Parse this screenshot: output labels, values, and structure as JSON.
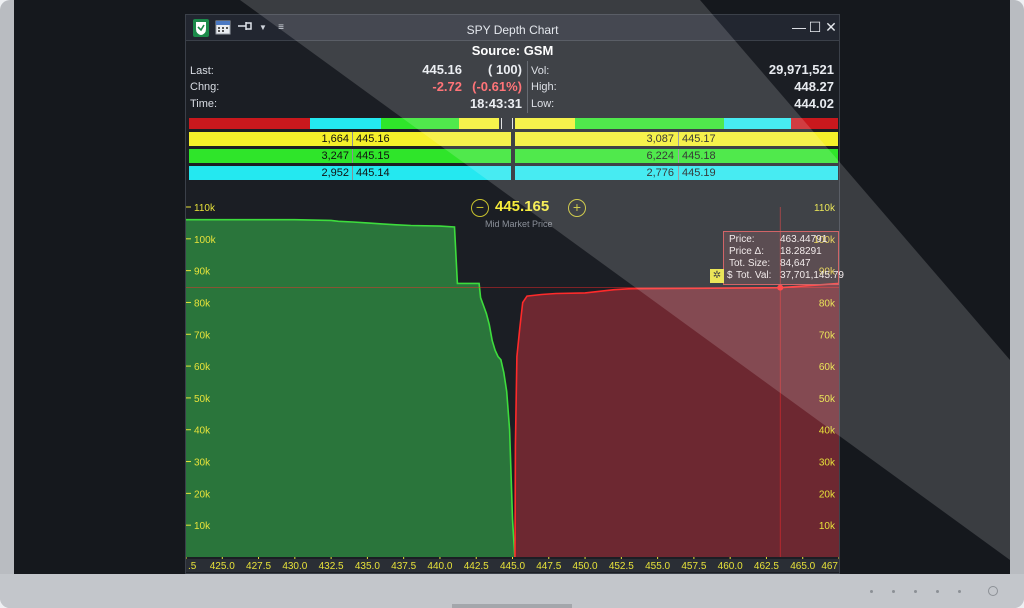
{
  "window": {
    "title": "SPY Depth Chart",
    "source_label": "Source: GSM",
    "minimize_glyph": "—",
    "maximize_glyph": "☐",
    "close_glyph": "✕"
  },
  "toolbar": {
    "icons": [
      "shield-logo-icon",
      "calendar-icon",
      "pin-icon",
      "dropdown-arrow-icon",
      "menu-icon"
    ]
  },
  "quote": {
    "last_label": "Last:",
    "last_price": "445.16",
    "last_size": "( 100)",
    "chng_label": "Chng:",
    "chng_value": "-2.72",
    "chng_pct": "(-0.61%)",
    "time_label": "Time:",
    "time_value": "18:43:31",
    "vol_label": "Vol:",
    "vol_value": "29,971,521",
    "high_label": "High:",
    "high_value": "448.27",
    "low_label": "Low:",
    "low_value": "444.02"
  },
  "colors": {
    "yellow": "#f5f02a",
    "green": "#2fe52a",
    "cyan": "#24e8f0",
    "red": "#c9181d",
    "bid_fill": "#2b7a3d",
    "ask_fill": "#7b2a34",
    "bid_line": "#3ddc3d",
    "ask_line": "#ff2a2a",
    "axis_text": "#e7e23a"
  },
  "ladder": {
    "bids": [
      {
        "size": "1,664",
        "price": "445.16"
      },
      {
        "size": "3,247",
        "price": "445.15"
      },
      {
        "size": "2,952",
        "price": "445.14"
      }
    ],
    "asks": [
      {
        "size": "3,087",
        "price": "445.17"
      },
      {
        "size": "6,224",
        "price": "445.18"
      },
      {
        "size": "2,776",
        "price": "445.19"
      }
    ]
  },
  "mid_market": {
    "value": "445.165",
    "label": "Mid Market Price",
    "minus": "−",
    "plus": "+"
  },
  "tooltip": {
    "price_label": "Price:",
    "price_value": "463.44791",
    "delta_label": "Price Δ:",
    "delta_value": "18.28291",
    "size_label": "Tot. Size:",
    "size_value": "84,647",
    "val_label": "Tot. Val:",
    "val_value": "37,701,145.79",
    "val_prefix": "$"
  },
  "chart_data": {
    "type": "area",
    "y_tick_labels": [
      "110k",
      "100k",
      "90k",
      "80k",
      "70k",
      "60k",
      "50k",
      "40k",
      "30k",
      "20k",
      "10k"
    ],
    "x_tick_labels": [
      ".5",
      "425.0",
      "427.5",
      "430.0",
      "432.5",
      "435.0",
      "437.5",
      "440.0",
      "442.5",
      "445.0",
      "447.5",
      "450.0",
      "452.5",
      "455.0",
      "457.5",
      "460.0",
      "462.5",
      "465.0",
      "467"
    ],
    "xlim": [
      422.5,
      467.5
    ],
    "ylim": [
      0,
      110000
    ],
    "mid": 445.165,
    "crosshair": {
      "x": 463.45,
      "y": 84647
    },
    "series": [
      {
        "side": "bid",
        "x": [
          422.5,
          430.0,
          432.5,
          433.0,
          434.0,
          435.0,
          436.0,
          437.0,
          438.0,
          440.0,
          441.0,
          441.2,
          442.7,
          442.8,
          443.0,
          443.2,
          443.4,
          443.6,
          443.8,
          444.0,
          444.2,
          444.3,
          444.4,
          444.6,
          444.8,
          445.0,
          445.16
        ],
        "y": [
          106000,
          106000,
          105800,
          105500,
          105300,
          105000,
          104700,
          104400,
          104200,
          104000,
          103700,
          86000,
          86000,
          81500,
          79000,
          76500,
          73000,
          68000,
          65000,
          63000,
          62000,
          60000,
          58000,
          52000,
          40000,
          12000,
          0
        ]
      },
      {
        "side": "ask",
        "x": [
          445.17,
          445.2,
          445.3,
          445.5,
          445.7,
          446.0,
          447.0,
          448.0,
          450.0,
          451.0,
          452.0,
          453.0,
          456.0,
          460.0,
          463.45,
          467.5
        ],
        "y": [
          0,
          35000,
          63000,
          72000,
          80000,
          82000,
          82500,
          82800,
          83000,
          83500,
          84000,
          84300,
          84400,
          84500,
          84647,
          86000
        ]
      }
    ]
  }
}
